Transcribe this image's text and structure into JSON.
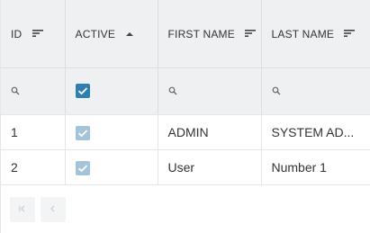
{
  "grid": {
    "columns": [
      {
        "label": "ID",
        "sort_icon": "filter-lines-icon"
      },
      {
        "label": "ACTIVE",
        "sort_icon": "sort-ascending-icon"
      },
      {
        "label": "FIRST NAME",
        "sort_icon": "filter-lines-icon"
      },
      {
        "label": "LAST NAME",
        "sort_icon": "filter-lines-icon"
      }
    ],
    "filter_row": {
      "id": "search-icon",
      "active": "checked",
      "first_name": "search-icon",
      "last_name": "search-icon"
    },
    "rows": [
      {
        "id": "1",
        "active": true,
        "first_name": "ADMIN",
        "last_name": "SYSTEM AD..."
      },
      {
        "id": "2",
        "active": true,
        "first_name": "User",
        "last_name": "Number 1"
      }
    ]
  },
  "pager": {
    "first_icon": "first-page-icon",
    "prev_icon": "previous-page-icon"
  },
  "colors": {
    "header_bg": "#eef0f2",
    "checkbox_active": "#2f7fb3",
    "checkbox_readonly": "#a5c3d9"
  }
}
